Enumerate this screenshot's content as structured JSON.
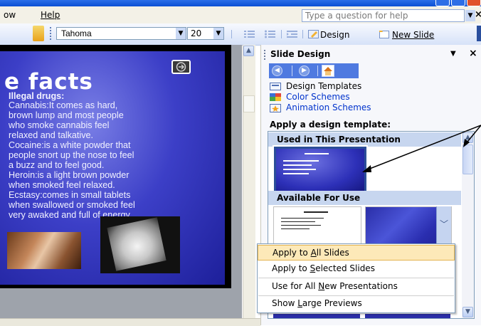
{
  "menu": {
    "item_view_partial": "ow",
    "item_help": "Help"
  },
  "help_box": {
    "placeholder": "Type a question for help"
  },
  "toolbar": {
    "font_name": "Tahoma",
    "font_size": "20",
    "design_label": "Design",
    "new_slide_label": "New Slide"
  },
  "slide": {
    "title": "e facts",
    "heading": "Illegal drugs:",
    "lines": [
      "Cannabis:It comes as hard,",
      "brown lump and most people",
      "who smoke cannabis feel",
      "relaxed and talkative.",
      "Cocaine:is a white powder that",
      "people snort up the nose to feel",
      "a buzz and to feel good.",
      "Heroin:is a light brown powder",
      "when smoked feel relaxed.",
      "Ecstasy:comes in small tablets",
      "when swallowed or smoked feel",
      "very awaked and full of energy."
    ]
  },
  "task_pane": {
    "title": "Slide Design",
    "links": [
      "Design Templates",
      "Color Schemes",
      "Animation Schemes"
    ],
    "apply_label": "Apply a design template:",
    "section_used": "Used in This Presentation",
    "section_available": "Available For Use"
  },
  "context_menu": {
    "items": [
      "Apply to All Slides",
      "Apply to Selected Slides",
      "Use for All New Presentations",
      "Show Large Previews"
    ]
  },
  "colors": {
    "selection": "#fde9b8",
    "pane_header": "#c7d6ef",
    "slide_blue": "#3c3fc7",
    "link": "#0033cc"
  },
  "icons": [
    "minimize-icon",
    "maximize-icon",
    "close-icon",
    "grip-icon",
    "dropdown-arrow-icon",
    "numbering-icon",
    "bullets-icon",
    "increase-indent-icon",
    "design-icon",
    "new-slide-icon",
    "pane-back-icon",
    "pane-forward-icon",
    "pane-home-icon",
    "pane-close-icon",
    "scroll-up-icon",
    "scroll-down-icon"
  ]
}
